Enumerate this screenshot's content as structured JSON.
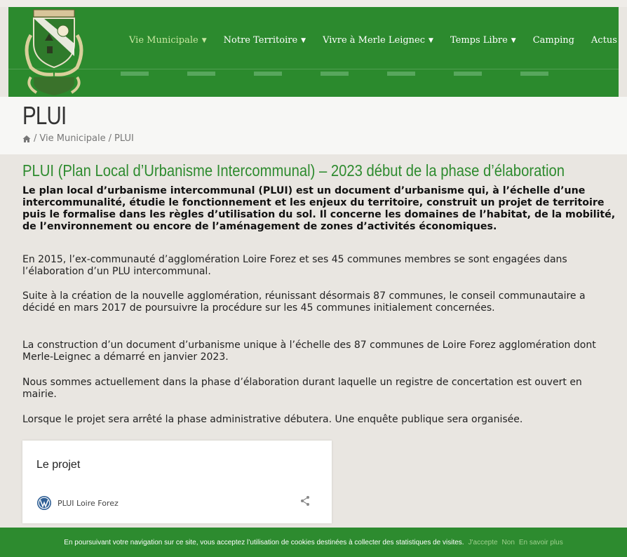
{
  "nav": {
    "items": [
      {
        "label": "Vie Municipale",
        "has_caret": true,
        "active": true
      },
      {
        "label": "Notre Territoire",
        "has_caret": true
      },
      {
        "label": "Vivre à Merle Leignec",
        "has_caret": true
      },
      {
        "label": "Temps Libre",
        "has_caret": true
      },
      {
        "label": "Camping",
        "has_caret": false
      },
      {
        "label": "Actus",
        "has_caret": false
      }
    ]
  },
  "page": {
    "title": "PLUI",
    "breadcrumb": {
      "sep1": "/",
      "section": "Vie Municipale",
      "sep2": "/",
      "current": "PLUI"
    }
  },
  "article": {
    "title": "PLUI (Plan Local d’Urbanisme Intercommunal) – 2023 début de la phase d’élaboration",
    "lead": "Le plan local d’urbanisme intercommunal (PLUI) est un document d’urbanisme qui, à l’échelle d’une intercommunalité, étudie le fonctionnement et les enjeux du territoire, construit un projet de territoire puis le formalise dans les règles d’utilisation du sol. Il concerne les domaines de l’habitat, de la mobilité, de l’environnement ou encore de l’aménagement de zones d’activités économiques.",
    "p1": "En 2015, l’ex-communauté d’agglomération Loire Forez et ses 45 communes membres se sont engagées dans l’élaboration d’un PLU intercommunal.",
    "p2": "Suite à la création de la nouvelle agglomération, réunissant désormais 87 communes, le conseil communautaire a décidé en mars 2017 de poursuivre la procédure sur les 45 communes initialement concernées.",
    "p3": "La construction d’un document d’urbanisme unique à l’échelle des 87 communes de Loire Forez agglomération dont Merle-Leignec a démarré en janvier 2023.",
    "p4": "Nous sommes actuellement dans la phase d’élaboration durant laquelle un registre de concertation est ouvert en mairie.",
    "p5": "Lorsque le projet sera arrêté la phase administrative débutera. Une enquête publique sera organisée."
  },
  "card": {
    "title": "Le projet",
    "source": "PLUI Loire Forez"
  },
  "cookie": {
    "text": "En poursuivant votre navigation sur ce site, vous acceptez l’utilisation de cookies destinées à collecter des statistiques de visites.",
    "accept": "J'accepte",
    "decline": "Non",
    "more": "En savoir plus"
  },
  "colors": {
    "brand_green": "#2c8a2e",
    "active_nav": "#c7e7a0",
    "title_green": "#2e8b2f"
  }
}
